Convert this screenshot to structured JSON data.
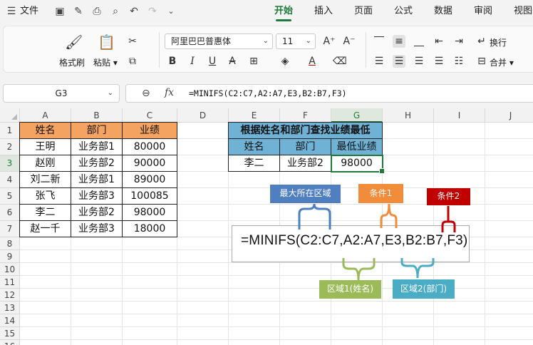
{
  "menubar": {
    "file_label": "文件",
    "tabs": [
      "开始",
      "插入",
      "页面",
      "公式",
      "数据",
      "审阅",
      "视图"
    ]
  },
  "ribbon": {
    "format_painter": "格式刷",
    "paste": "粘贴",
    "font_name": "阿里巴巴普惠体",
    "font_size": "11",
    "wrap": "换行",
    "merge": "合并"
  },
  "formula_bar": {
    "cell_ref": "G3",
    "formula": "=MINIFS(C2:C7,A2:A7,E3,B2:B7,F3)"
  },
  "sheet": {
    "columns": [
      "A",
      "B",
      "C",
      "D",
      "E",
      "F",
      "G",
      "H",
      "I",
      "J"
    ],
    "rows": [
      "1",
      "2",
      "3",
      "4",
      "5",
      "6",
      "7",
      "8",
      "9",
      "10",
      "11",
      "12",
      "13",
      "14",
      "15",
      "16"
    ],
    "table1": {
      "headers": [
        "姓名",
        "部门",
        "业绩"
      ],
      "rows": [
        [
          "王明",
          "业务部1",
          "80000"
        ],
        [
          "赵刚",
          "业务部2",
          "90000"
        ],
        [
          "刘二新",
          "业务部1",
          "89000"
        ],
        [
          "张飞",
          "业务部3",
          "100085"
        ],
        [
          "李二",
          "业务部2",
          "98000"
        ],
        [
          "赵一千",
          "业务部3",
          "18000"
        ]
      ]
    },
    "table2": {
      "title": "根据姓名和部门查找业绩最低",
      "headers": [
        "姓名",
        "部门",
        "最低业绩"
      ],
      "values": [
        "李二",
        "业务部2",
        "98000"
      ]
    }
  },
  "annotation": {
    "formula": "=MINIFS(C2:C7,A2:A7,E3,B2:B7,F3)",
    "labels": {
      "max_range": "最大所在区域",
      "cond1": "条件1",
      "cond2": "条件2",
      "range1": "区域1(姓名)",
      "range2": "区域2(部门)"
    },
    "colors": {
      "max_range": "#4f7fbf",
      "cond1": "#f08c3a",
      "cond2": "#c00000",
      "range1": "#9bbb59",
      "range2": "#4bacc6"
    }
  },
  "colors": {
    "accent": "#1f7a3a",
    "header_orange": "#f4a460",
    "header_blue": "#6fb2d6"
  }
}
